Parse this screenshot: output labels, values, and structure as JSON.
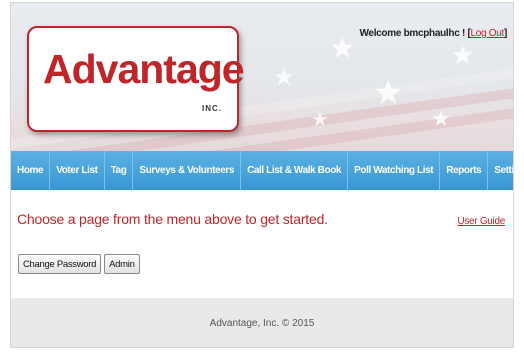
{
  "header": {
    "logo_text": "Advantage",
    "logo_suffix": "INC.",
    "welcome_text": "Welcome bmcphaulhc ! ",
    "logout_open": "[",
    "logout_label": "Log Out",
    "logout_close": "]"
  },
  "nav": {
    "items": [
      {
        "label": "Home"
      },
      {
        "label": "Voter List"
      },
      {
        "label": "Tag"
      },
      {
        "label": "Surveys & Volunteers"
      },
      {
        "label": "Call List & Walk Book"
      },
      {
        "label": "Poll Watching List"
      },
      {
        "label": "Reports"
      },
      {
        "label": "Settings"
      }
    ]
  },
  "main": {
    "heading": "Choose a page from the menu above to get started.",
    "user_guide_label": "User Guide",
    "buttons": {
      "change_password": "Change Password",
      "admin": "Admin"
    }
  },
  "footer": {
    "copyright": "Advantage, Inc. © 2015"
  },
  "colors": {
    "brand_red": "#c0252a",
    "nav_blue": "#3897d4",
    "footer_bg": "#e9e9e9"
  }
}
